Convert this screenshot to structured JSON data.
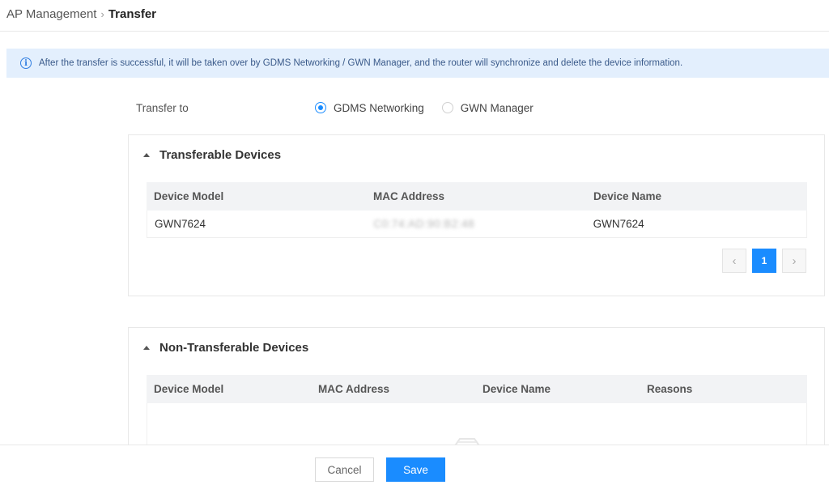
{
  "breadcrumb": {
    "parent": "AP Management",
    "separator": "›",
    "current": "Transfer"
  },
  "banner": {
    "icon": "info-icon",
    "text": "After the transfer is successful, it will be taken over by GDMS Networking / GWN Manager, and the router will synchronize and delete the device information."
  },
  "transfer": {
    "label": "Transfer to",
    "options": [
      {
        "label": "GDMS Networking",
        "selected": true
      },
      {
        "label": "GWN Manager",
        "selected": false
      }
    ]
  },
  "transferable": {
    "title": "Transferable Devices",
    "columns": [
      "Device Model",
      "MAC Address",
      "Device Name"
    ],
    "rows": [
      {
        "model": "GWN7624",
        "mac": "C0:74:AD:90:B2:48",
        "name": "GWN7624"
      }
    ],
    "pagination": {
      "prev": "‹",
      "current": "1",
      "next": "›"
    }
  },
  "non_transferable": {
    "title": "Non-Transferable Devices",
    "columns": [
      "Device Model",
      "MAC Address",
      "Device Name",
      "Reasons"
    ],
    "rows": []
  },
  "footer": {
    "cancel_label": "Cancel",
    "save_label": "Save"
  },
  "colors": {
    "accent": "#1a8cff",
    "banner_bg": "#e3effd",
    "header_bg": "#f2f3f5"
  }
}
